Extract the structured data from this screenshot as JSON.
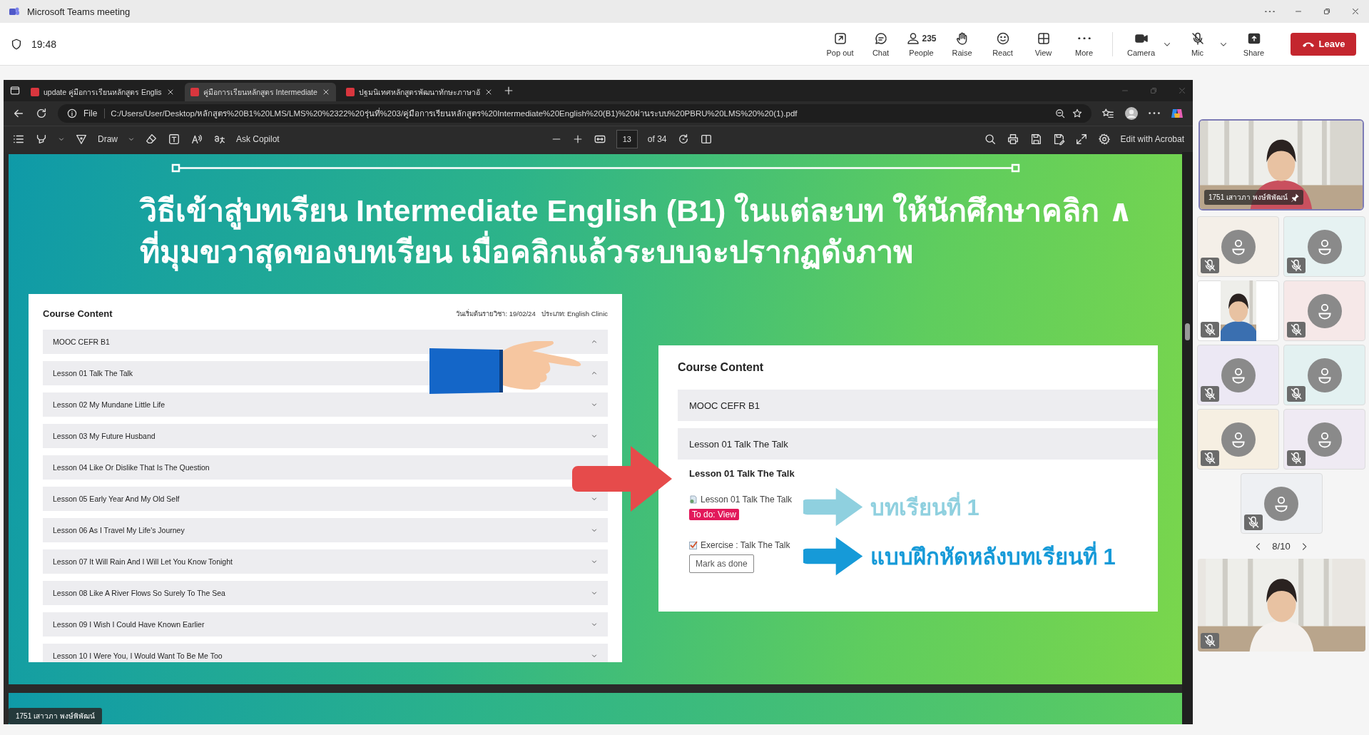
{
  "window": {
    "title": "Microsoft Teams meeting"
  },
  "meeting": {
    "elapsed": "19:48"
  },
  "meeting_toolbar": [
    {
      "label": "Pop out",
      "kind": "plain"
    },
    {
      "label": "Chat",
      "kind": "plain"
    },
    {
      "label": "People",
      "kind": "plain",
      "count": "235"
    },
    {
      "label": "Raise",
      "kind": "plain"
    },
    {
      "label": "React",
      "kind": "plain"
    },
    {
      "label": "View",
      "kind": "plain"
    },
    {
      "label": "More",
      "kind": "plain"
    },
    {
      "label": "Camera",
      "kind": "split"
    },
    {
      "label": "Mic",
      "kind": "split"
    },
    {
      "label": "Share",
      "kind": "plain"
    }
  ],
  "leave_button": {
    "label": "Leave"
  },
  "browser": {
    "tabs": [
      {
        "title": "update คู่มือการเรียนหลักสูตร Englis",
        "selected": false
      },
      {
        "title": "คู่มือการเรียนหลักสูตร Intermediate",
        "selected": true
      },
      {
        "title": "ปฐมนิเทศหลักสูตรพัฒนาทักษะภาษาอั",
        "selected": false
      }
    ],
    "address": {
      "scheme": "File",
      "url": "C:/Users/User/Desktop/หลักสูตร%20B1%20LMS/LMS%20%2322%20รุ่นที่%203/คู่มือการเรียนหลักสูตร%20Intermediate%20English%20(B1)%20ผ่านระบบ%20PBRU%20LMS%20%20(1).pdf"
    },
    "pdf_toolbar": {
      "draw_label": "Draw",
      "copilot_label": "Ask Copilot",
      "page": "13",
      "page_total": "of 34",
      "acrobat_label": "Edit with Acrobat"
    }
  },
  "slide": {
    "title_lines": [
      "วิธีเข้าสู่บทเรียน Intermediate English (B1) ในแต่ละบท ให้นักศึกษาคลิก ∧",
      "ที่มุมขวาสุดของบทเรียน เมื่อคลิกแล้วระบบจะปรากฏดังภาพ"
    ],
    "course_panel": {
      "title": "Course Content",
      "start_date": "วันเริ่มต้นรายวิชา: 19/02/24",
      "category": "ประเภท: English Clinic",
      "rows": [
        {
          "label": "MOOC CEFR B1",
          "expanded": true
        },
        {
          "label": "Lesson 01 Talk The Talk",
          "expanded": true
        },
        {
          "label": "Lesson 02 My Mundane Little Life",
          "expanded": false
        },
        {
          "label": "Lesson 03 My Future Husband",
          "expanded": false
        },
        {
          "label": "Lesson 04 Like Or Dislike That Is The Question"
        },
        {
          "label": "Lesson 05 Early Year And My Old Self",
          "expanded": false
        },
        {
          "label": "Lesson 06 As I Travel My Life's Journey",
          "expanded": false
        },
        {
          "label": "Lesson 07 It Will Rain And I Will Let You Know Tonight",
          "expanded": false
        },
        {
          "label": "Lesson 08 Like A River Flows So Surely To The Sea",
          "expanded": false
        },
        {
          "label": "Lesson 09 I Wish I Could Have Known Earlier",
          "expanded": false
        },
        {
          "label": "Lesson 10 I Were You, I Would Want To Be Me Too",
          "expanded": false
        }
      ]
    },
    "detail_panel": {
      "title": "Course Content",
      "rows": [
        "MOOC CEFR B1",
        "Lesson 01 Talk The Talk"
      ],
      "section_title": "Lesson 01 Talk The Talk",
      "activities": [
        {
          "kind": "lesson",
          "label": "Lesson 01 Talk The Talk",
          "action": {
            "kind": "badge",
            "label": "To do: View"
          },
          "note": "บทเรียนที่ 1",
          "color": "#8fd0df"
        },
        {
          "kind": "exercise",
          "label": "Exercise : Talk The Talk",
          "action": {
            "kind": "button",
            "label": "Mark as done"
          },
          "note": "แบบฝึกหัดหลังบทเรียนที่ 1",
          "color": "#169ad8"
        }
      ]
    }
  },
  "presenter_label": "1751 เสาวภา พงษ์พิพัฒน์",
  "participants": {
    "spotlight": {
      "name": "1751 เสาวภา พงษ์พิพัฒน์",
      "pinned": true
    },
    "tiles": [
      {
        "kind": "avatar",
        "muted": true
      },
      {
        "kind": "avatar",
        "muted": true
      },
      {
        "kind": "video",
        "muted": true
      },
      {
        "kind": "avatar",
        "muted": true
      },
      {
        "kind": "avatar",
        "muted": true
      },
      {
        "kind": "avatar",
        "muted": true
      },
      {
        "kind": "avatar",
        "muted": true
      },
      {
        "kind": "avatar",
        "muted": true
      },
      {
        "kind": "avatar",
        "muted": true
      }
    ],
    "pager": "8/10",
    "self_view": {
      "muted": true
    }
  }
}
